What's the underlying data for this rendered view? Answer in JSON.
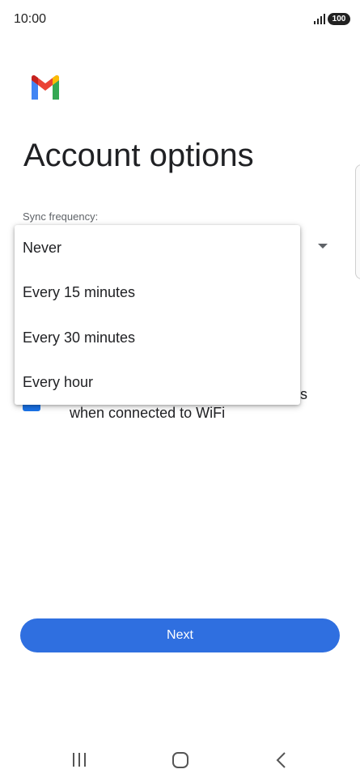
{
  "status_bar": {
    "time": "10:00",
    "battery": "100"
  },
  "page": {
    "title": "Account options"
  },
  "sync": {
    "label": "Sync frequency:",
    "menu_options": [
      "Never",
      "Every 15 minutes",
      "Every 30 minutes",
      "Every hour"
    ]
  },
  "download_attachments": {
    "label_visible": "nts\nwhen connected to WiFi",
    "checked": true
  },
  "actions": {
    "next_label": "Next"
  },
  "colors": {
    "accent": "#2f6fe0",
    "checkbox": "#1a73e8",
    "gmail_red": "#ea4335",
    "gmail_blue": "#4285f4",
    "gmail_green": "#34a853",
    "gmail_yellow": "#fbbc04"
  },
  "icons": {
    "logo": "gmail-logo-icon",
    "signal": "signal-icon",
    "battery": "battery-icon",
    "recents": "recents-icon",
    "home": "home-icon",
    "back": "back-icon"
  }
}
